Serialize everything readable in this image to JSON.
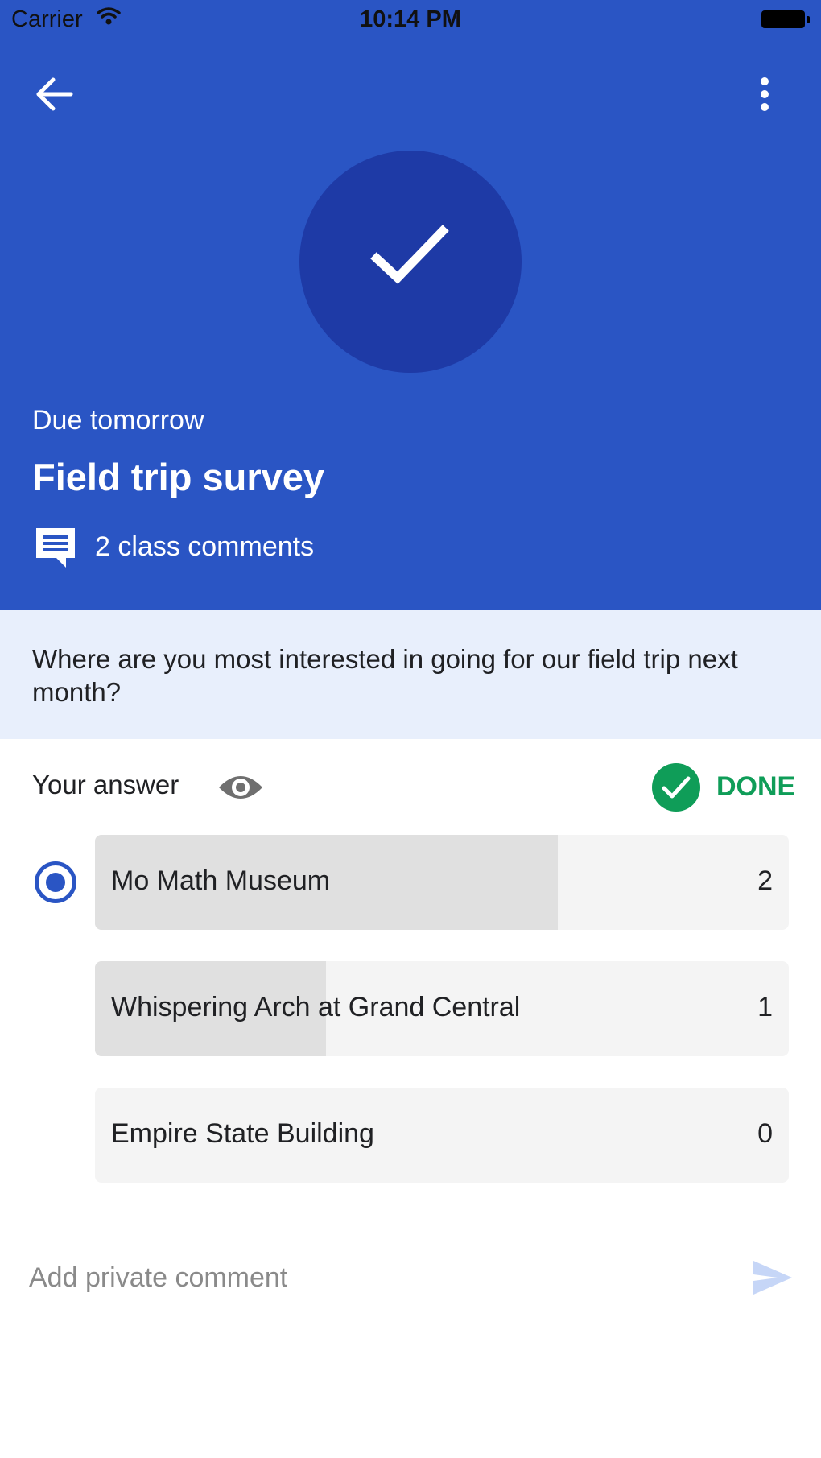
{
  "status_bar": {
    "carrier": "Carrier",
    "time": "10:14 PM",
    "wifi_icon": "wifi-icon",
    "battery_icon": "battery-icon"
  },
  "header": {
    "background_color": "#2a55c4",
    "back_icon": "arrow-back-icon",
    "menu_icon": "more-vert-icon",
    "status_icon": "check-icon",
    "due": "Due tomorrow",
    "title": "Field trip survey",
    "comments_icon": "comment-icon",
    "comments": "2 class comments"
  },
  "question": {
    "text": "Where are you most interested in going for our field trip next month?"
  },
  "answer": {
    "label": "Your answer",
    "visibility_icon": "eye-icon",
    "status_icon": "check-circle-icon",
    "status": "DONE",
    "status_color": "#0f9d58"
  },
  "options": [
    {
      "label": "Mo Math Museum",
      "count": "2",
      "selected": true,
      "share": 0.667
    },
    {
      "label": "Whispering Arch at Grand Central",
      "count": "1",
      "selected": false,
      "share": 0.333
    },
    {
      "label": "Empire State Building",
      "count": "0",
      "selected": false,
      "share": 0
    }
  ],
  "private_comment": {
    "placeholder": "Add private comment",
    "value": "",
    "send_icon": "send-icon"
  }
}
